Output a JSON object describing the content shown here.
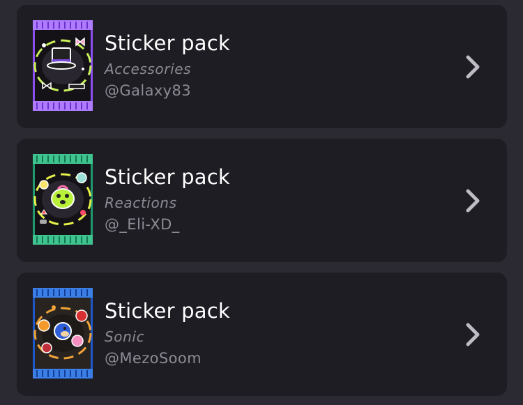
{
  "sticker_packs": [
    {
      "title": "Sticker pack",
      "subtitle": "Accessories",
      "author": "@Galaxy83",
      "pack_color": "#8a4ff0",
      "pack_color_light": "#b07cff",
      "ring_color": "#c8f05a",
      "icon": "top-hat-icon"
    },
    {
      "title": "Sticker pack",
      "subtitle": "Reactions",
      "author": "@_Eli-XD_",
      "pack_color": "#1f9a6e",
      "pack_color_light": "#3fc48f",
      "ring_color": "#e6f04a",
      "icon": "reaction-face-icon"
    },
    {
      "title": "Sticker pack",
      "subtitle": "Sonic",
      "author": "@MezoSoom",
      "pack_color": "#1e58c8",
      "pack_color_light": "#3b7fe6",
      "ring_color": "#f0a43a",
      "icon": "sonic-characters-icon"
    }
  ],
  "colors": {
    "background": "#2b2931",
    "card": "#1e1d23",
    "title": "#ffffff",
    "secondary_text": "#8d8a95",
    "chevron": "#bfbcc6"
  }
}
